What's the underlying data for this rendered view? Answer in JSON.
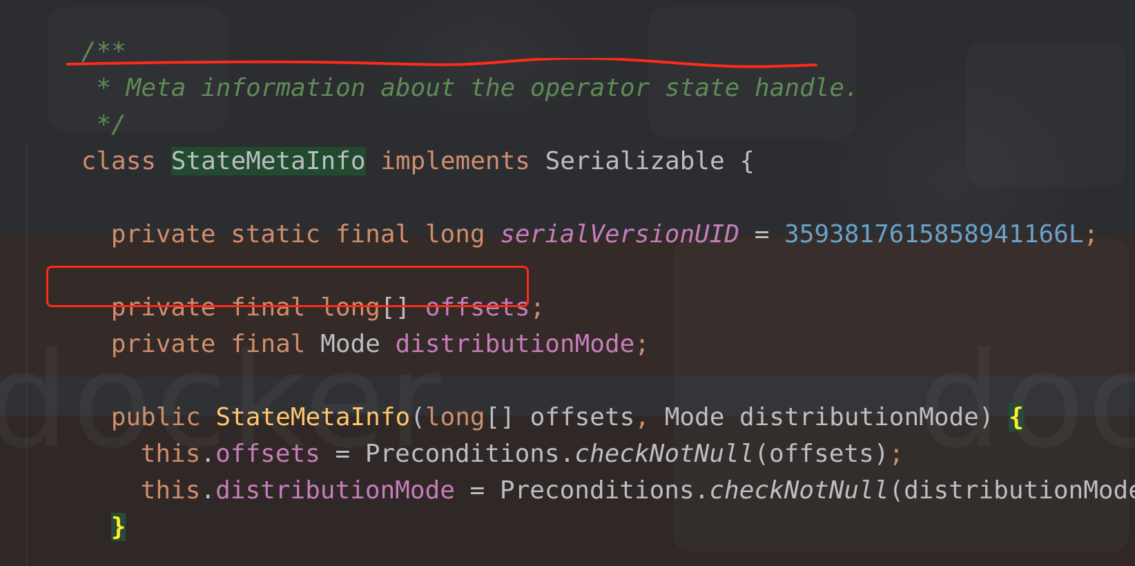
{
  "editor": {
    "comment": {
      "open": "/**",
      "line": " * Meta information about the operator state handle.",
      "close": " */"
    },
    "class_decl": {
      "kw_class": "class ",
      "name": "StateMetaInfo",
      "kw_implements": " implements ",
      "iface": "Serializable",
      "brace": " {"
    },
    "serial_line": {
      "kw": "private static final long ",
      "field": "serialVersionUID",
      "eq": " = ",
      "value": "3593817615858941166L",
      "semi": ";"
    },
    "offsets_line": {
      "kw": "private final ",
      "type_kw": "long",
      "brackets": "[] ",
      "field": "offsets",
      "semi": ";"
    },
    "mode_line": {
      "kw": "private final ",
      "type": "Mode ",
      "field": "distributionMode",
      "semi": ";"
    },
    "ctor_line": {
      "kw": "public ",
      "name": "StateMetaInfo",
      "paren_open": "(",
      "type_kw": "long",
      "params_rest": "[] offsets",
      "comma": ", ",
      "params_rest2": "Mode distributionMode)",
      "space": " ",
      "brace": "{"
    },
    "assign1": {
      "this": "this",
      "dot": ".",
      "field": "offsets",
      "eq": " = Preconditions.",
      "method": "checkNotNull",
      "args": "(offsets)",
      "semi": ";"
    },
    "assign2": {
      "this": "this",
      "dot": ".",
      "field": "distributionMode",
      "eq": " = Preconditions.",
      "method": "checkNotNull",
      "args": "(distributionMode)",
      "semi": ";"
    },
    "close_brace": "}"
  },
  "background_watermark": "docker",
  "colors": {
    "background": "#2b2d30",
    "comment": "#5f8b57",
    "keyword": "#cf8e6d",
    "field": "#c77dbb",
    "number": "#6aa2c9",
    "method": "#ffc66d",
    "annotation_red": "#ff2a1a"
  }
}
